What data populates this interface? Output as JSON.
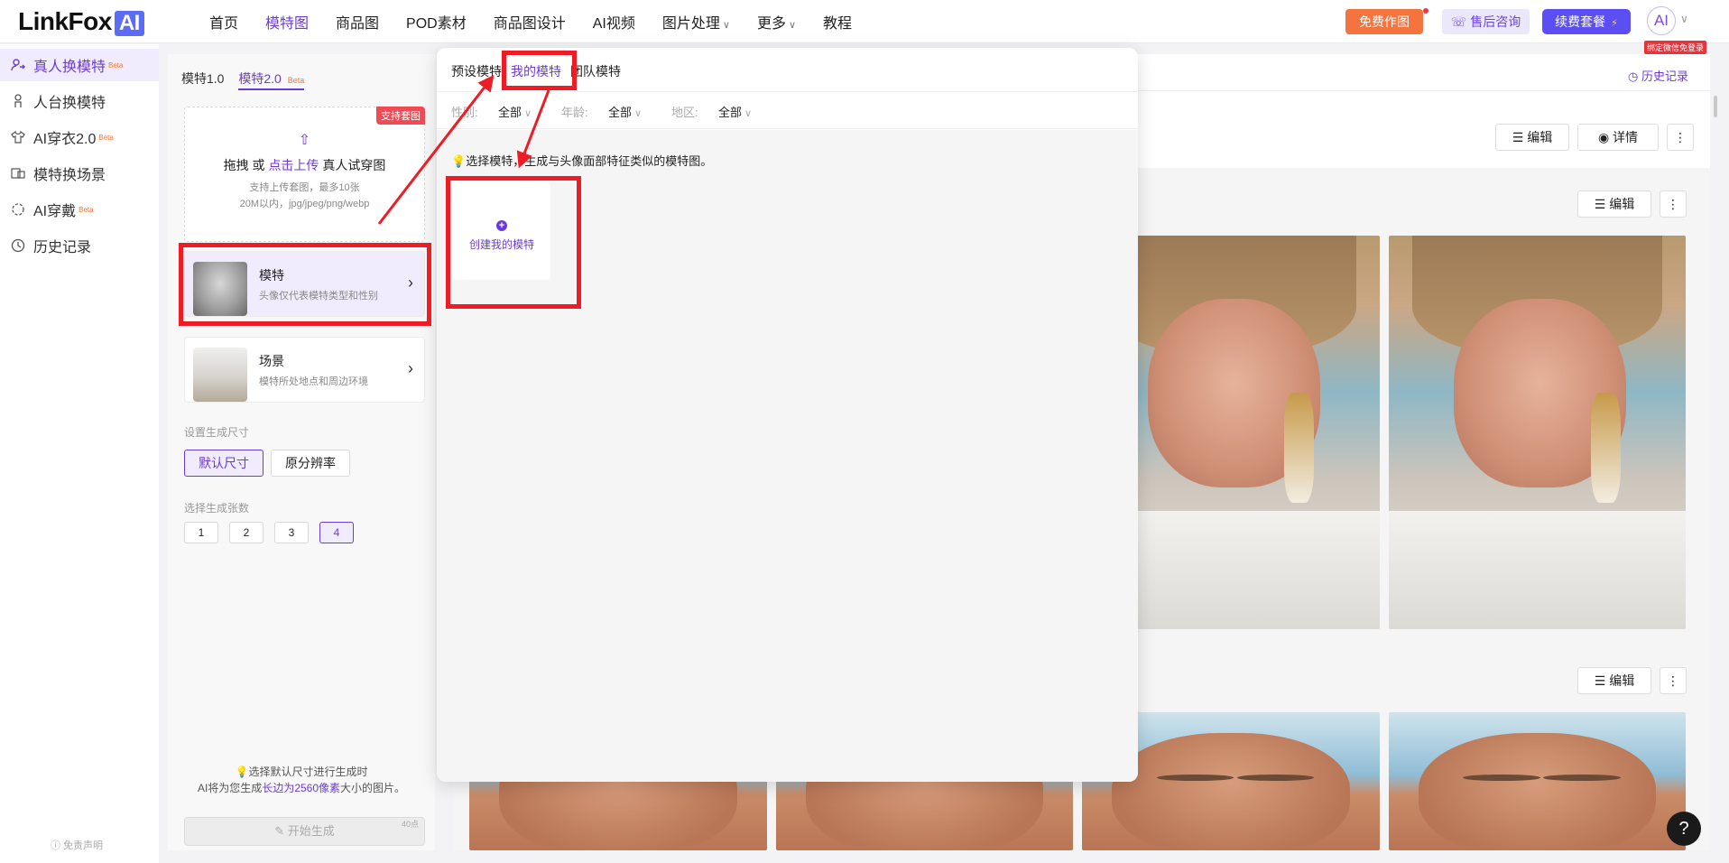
{
  "header": {
    "logo_text": "LinkFox",
    "logo_ai": "AI",
    "nav": [
      {
        "label": "首页",
        "has_chevron": false
      },
      {
        "label": "模特图",
        "has_chevron": false,
        "active": true
      },
      {
        "label": "商品图",
        "has_chevron": false
      },
      {
        "label": "POD素材",
        "has_chevron": false
      },
      {
        "label": "商品图设计",
        "has_chevron": false
      },
      {
        "label": "AI视频",
        "has_chevron": false
      },
      {
        "label": "图片处理",
        "has_chevron": true
      },
      {
        "label": "更多",
        "has_chevron": true
      },
      {
        "label": "教程",
        "has_chevron": false
      }
    ],
    "free_btn": "免费作图",
    "after_sales_btn": "售后咨询",
    "renew_btn": "续费套餐",
    "avatar_text": "AI",
    "avatar_badge": "绑定微信免登录",
    "chevron": "∨"
  },
  "sidebar": {
    "items": [
      {
        "label": "真人换模特",
        "beta": "Beta",
        "active": true,
        "icon": "swap-user-icon"
      },
      {
        "label": "人台换模特",
        "beta": "",
        "icon": "mannequin-icon"
      },
      {
        "label": "AI穿衣2.0",
        "beta": "Beta",
        "icon": "shirt-icon"
      },
      {
        "label": "模特换场景",
        "beta": "",
        "icon": "scene-icon"
      },
      {
        "label": "AI穿戴",
        "beta": "Beta",
        "icon": "wear-icon"
      },
      {
        "label": "历史记录",
        "beta": "",
        "icon": "clock-icon"
      }
    ],
    "disclaimer": "免责声明"
  },
  "config": {
    "tabs": [
      "模特1.0",
      "模特2.0"
    ],
    "tab_beta": "Beta",
    "upload": {
      "tag": "支持套图",
      "drag_text": "拖拽 或 ",
      "click_text": "点击上传",
      "tail_text": " 真人试穿图",
      "sub1": "支持上传套图，最多10张",
      "sub2": "20M以内，jpg/jpeg/png/webp"
    },
    "model_card": {
      "title": "模特",
      "sub": "头像仅代表模特类型和性别"
    },
    "scene_card": {
      "title": "场景",
      "sub": "模特所处地点和周边环境"
    },
    "size_label": "设置生成尺寸",
    "size_options": [
      "默认尺寸",
      "原分辨率"
    ],
    "count_label": "选择生成张数",
    "counts": [
      "1",
      "2",
      "3",
      "4"
    ],
    "tip_line1": "选择默认尺寸进行生成时",
    "tip_line2_a": "AI将为您生成",
    "tip_line2_link": "长边为2560像素",
    "tip_line2_b": "大小的图片。",
    "generate_btn": "开始生成",
    "generate_cost": "40点"
  },
  "main": {
    "history_link": "历史记录",
    "edit_btn": "编辑",
    "detail_btn": "详情",
    "more_btn": "⋮"
  },
  "modal": {
    "tabs": [
      "预设模特",
      "我的模特",
      "团队模特"
    ],
    "filters": [
      {
        "label": "性别:",
        "value": "全部"
      },
      {
        "label": "年龄:",
        "value": "全部"
      },
      {
        "label": "地区:",
        "value": "全部"
      }
    ],
    "hint": "选择模特，生成与头像面部特征类似的模特图。",
    "create_text": "创建我的模特"
  },
  "help_text": "?",
  "colors": {
    "accent": "#6b3bd8",
    "highlight": "#ee1c25"
  }
}
